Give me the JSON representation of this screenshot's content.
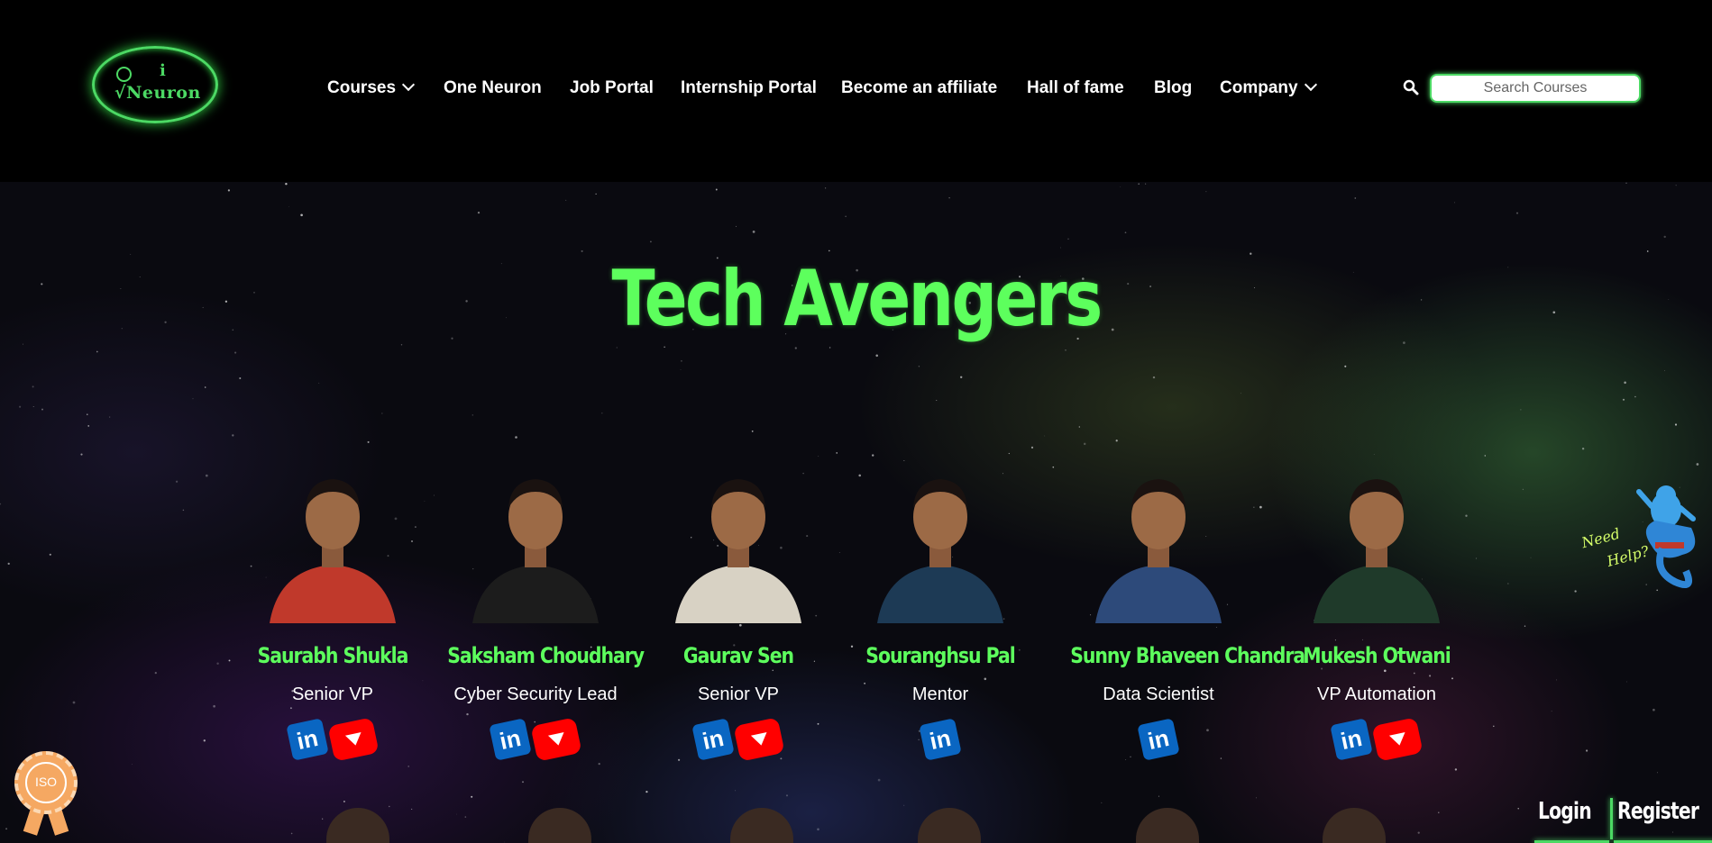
{
  "header": {
    "logo_text_top": "i",
    "logo_text_bottom": "√Neuron",
    "nav": [
      {
        "label": "Courses",
        "dropdown": true
      },
      {
        "label": "One Neuron",
        "dropdown": false
      },
      {
        "label": "Job Portal",
        "dropdown": false
      },
      {
        "label": "Internship Portal",
        "dropdown": false
      },
      {
        "label": "Become an affiliate",
        "dropdown": false
      },
      {
        "label": "Hall of fame",
        "dropdown": false
      },
      {
        "label": "Blog",
        "dropdown": false
      },
      {
        "label": "Company",
        "dropdown": true
      }
    ],
    "search_placeholder": "Search Courses"
  },
  "main": {
    "title": "Tech Avengers",
    "mentors": [
      {
        "name": "Saurabh Shukla",
        "role": "Senior VP",
        "linkedin": true,
        "youtube": true,
        "shirt": "#c0392b"
      },
      {
        "name": "Saksham Choudhary",
        "role": "Cyber Security Lead",
        "linkedin": true,
        "youtube": true,
        "shirt": "#1c1c1c"
      },
      {
        "name": "Gaurav Sen",
        "role": "Senior VP",
        "linkedin": true,
        "youtube": true,
        "shirt": "#d8d2c4"
      },
      {
        "name": "Souranghsu Pal",
        "role": "Mentor",
        "linkedin": true,
        "youtube": false,
        "shirt": "#1d3a55"
      },
      {
        "name": "Sunny Bhaveen Chandra",
        "role": "Data Scientist",
        "linkedin": true,
        "youtube": false,
        "shirt": "#2d4a7a"
      },
      {
        "name": "Mukesh Otwani",
        "role": "VP Automation",
        "linkedin": true,
        "youtube": true,
        "shirt": "#1f3a2a"
      }
    ],
    "linkedin_label": "in"
  },
  "help_widget": {
    "line1": "Need",
    "line2": "Help?"
  },
  "iso_badge": {
    "text": "ISO"
  },
  "auth": {
    "login": "Login",
    "register": "Register"
  },
  "colors": {
    "accent": "#5dff5d",
    "linkedin": "#0a66c2",
    "youtube": "#ff0000"
  }
}
